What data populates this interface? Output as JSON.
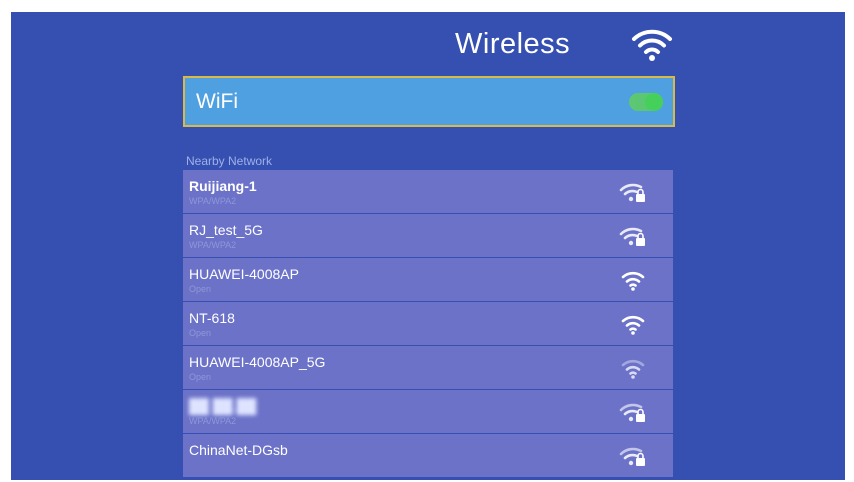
{
  "header": {
    "title": "Wireless",
    "icon": "wifi-icon"
  },
  "wifi_toggle": {
    "label": "WiFi",
    "enabled": true,
    "colors": {
      "row_bg": "#4fa0e0",
      "border": "#d9b94a",
      "toggle": "#44d944"
    }
  },
  "nearby": {
    "section_label": "Nearby Network",
    "networks": [
      {
        "name": "Ruijiang-1",
        "security": "WPA/WPA2",
        "icon": "wifi-lock-icon"
      },
      {
        "name": "RJ_test_5G",
        "security": "WPA/WPA2",
        "icon": "wifi-lock-icon"
      },
      {
        "name": "HUAWEI-4008AP",
        "security": "Open",
        "icon": "wifi-icon"
      },
      {
        "name": "NT-618",
        "security": "Open",
        "icon": "wifi-icon"
      },
      {
        "name": "HUAWEI-4008AP_5G",
        "security": "Open",
        "icon": "wifi-icon"
      },
      {
        "name": "██ ██.██",
        "security": "WPA/WPA2",
        "icon": "wifi-lock-icon"
      },
      {
        "name": "ChinaNet-DGsb",
        "security": "",
        "icon": "wifi-lock-icon"
      }
    ]
  },
  "colors": {
    "background": "#3550b0",
    "row": "#6b72c8"
  }
}
